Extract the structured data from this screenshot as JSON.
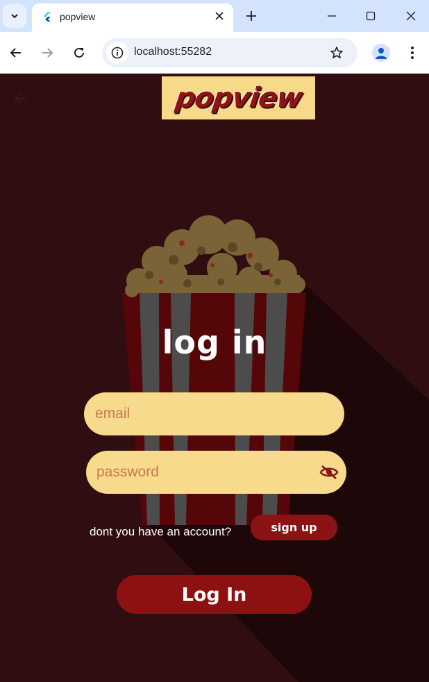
{
  "browser": {
    "tab_title": "popview",
    "url": "localhost:55282"
  },
  "app": {
    "logo_text": "popview",
    "heading": "log in",
    "email_placeholder": "email",
    "password_placeholder": "password",
    "signup_question": "dont you have an account?",
    "signup_label": "sign up",
    "login_label": "Log In"
  },
  "colors": {
    "background": "#2f0d10",
    "field": "#f8da8c",
    "accent": "#8e1111",
    "logo_bg": "#f7d98a"
  },
  "icons": [
    "chevron-down-icon",
    "flutter-icon",
    "close-icon",
    "plus-icon",
    "minimize-icon",
    "maximize-icon",
    "back-icon",
    "forward-icon",
    "reload-icon",
    "info-icon",
    "star-icon",
    "profile-icon",
    "menu-icon",
    "arrow-back-icon",
    "eye-off-icon"
  ]
}
